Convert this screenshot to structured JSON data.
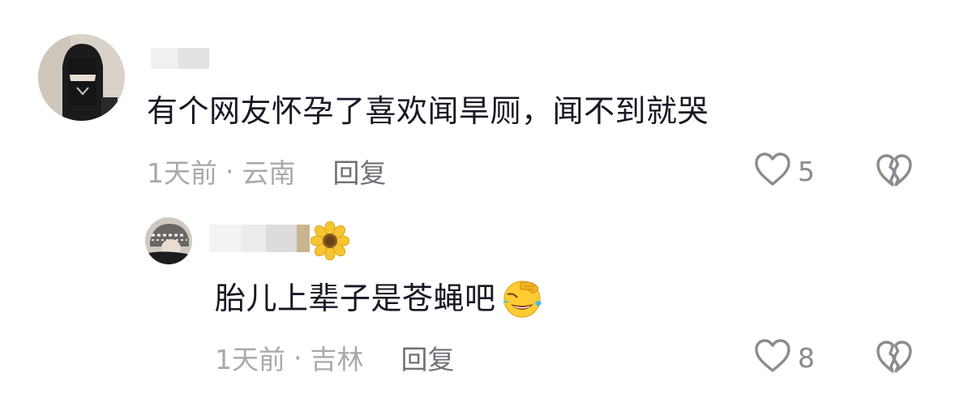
{
  "comments": [
    {
      "text": "有个网友怀孕了喜欢闻旱厕，闻不到就哭",
      "time": "1天前",
      "dot": "·",
      "location": "云南",
      "reply_label": "回复",
      "likes": "5"
    },
    {
      "text": "胎儿上辈子是苍蝇吧",
      "emoji": "face-palm-laughing-emoji",
      "badge": "sunflower-icon",
      "time": "1天前",
      "dot": "·",
      "location": "吉林",
      "reply_label": "回复",
      "likes": "8"
    }
  ],
  "colors": {
    "text": "#161823",
    "meta": "#a9a9ab",
    "reply": "#6f7076",
    "icon": "#8a8b91"
  }
}
